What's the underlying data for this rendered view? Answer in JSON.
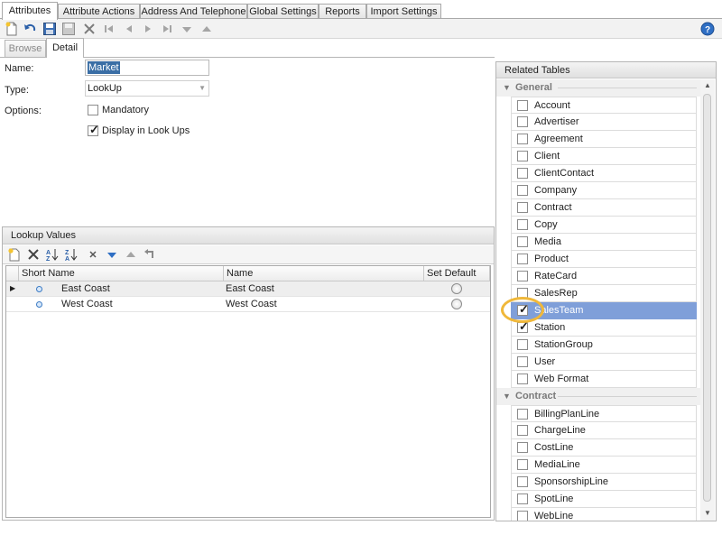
{
  "top_tabs": [
    {
      "label": "Attributes",
      "active": true
    },
    {
      "label": "Attribute Actions",
      "active": false
    },
    {
      "label": "Address And Telephone",
      "active": false
    },
    {
      "label": "Global Settings",
      "active": false
    },
    {
      "label": "Reports",
      "active": false
    },
    {
      "label": "Import Settings",
      "active": false
    }
  ],
  "toolbar_icons": [
    "new-icon",
    "undo-icon",
    "save-icon",
    "save-copy-icon",
    "delete-icon",
    "first-record-icon",
    "previous-record-icon",
    "next-record-icon",
    "last-record-icon",
    "move-down-icon",
    "move-up-icon"
  ],
  "help_icon": "help-icon",
  "sub_tabs": [
    {
      "label": "Browse",
      "active": false
    },
    {
      "label": "Detail",
      "active": true
    }
  ],
  "form": {
    "name_label": "Name:",
    "name_value": "Market",
    "type_label": "Type:",
    "type_value": "LookUp",
    "options_label": "Options:",
    "mandatory_label": "Mandatory",
    "mandatory_checked": false,
    "display_lookups_label": "Display in Look Ups",
    "display_lookups_checked": true
  },
  "lookup": {
    "title": "Lookup Values",
    "toolbar_icons": [
      "add-icon",
      "delete-icon",
      "sort-ascending-icon",
      "sort-descending-icon",
      "clear-icon",
      "move-down-icon",
      "move-up-icon",
      "undo-icon"
    ],
    "columns": [
      "Short Name",
      "Name",
      "Set Default"
    ],
    "rows": [
      {
        "short_name": "East Coast",
        "name": "East Coast",
        "current": true
      },
      {
        "short_name": "West Coast",
        "name": "West Coast",
        "current": false
      }
    ]
  },
  "related": {
    "title": "Related Tables",
    "groups": [
      {
        "name": "General",
        "items": [
          {
            "label": "Account",
            "checked": false
          },
          {
            "label": "Advertiser",
            "checked": false
          },
          {
            "label": "Agreement",
            "checked": false
          },
          {
            "label": "Client",
            "checked": false
          },
          {
            "label": "ClientContact",
            "checked": false
          },
          {
            "label": "Company",
            "checked": false
          },
          {
            "label": "Contract",
            "checked": false
          },
          {
            "label": "Copy",
            "checked": false
          },
          {
            "label": "Media",
            "checked": false
          },
          {
            "label": "Product",
            "checked": false
          },
          {
            "label": "RateCard",
            "checked": false
          },
          {
            "label": "SalesRep",
            "checked": false
          },
          {
            "label": "SalesTeam",
            "checked": true,
            "selected": true
          },
          {
            "label": "Station",
            "checked": true
          },
          {
            "label": "StationGroup",
            "checked": false
          },
          {
            "label": "User",
            "checked": false
          },
          {
            "label": "Web Format",
            "checked": false
          }
        ]
      },
      {
        "name": "Contract",
        "items": [
          {
            "label": "BillingPlanLine",
            "checked": false
          },
          {
            "label": "ChargeLine",
            "checked": false
          },
          {
            "label": "CostLine",
            "checked": false
          },
          {
            "label": "MediaLine",
            "checked": false
          },
          {
            "label": "SponsorshipLine",
            "checked": false
          },
          {
            "label": "SpotLine",
            "checked": false
          },
          {
            "label": "WebLine",
            "checked": false
          }
        ]
      }
    ]
  },
  "colors": {
    "selection": "#7f9fd9",
    "highlight_ring": "#f0b83a",
    "name_selection": "#3a6ea5"
  }
}
